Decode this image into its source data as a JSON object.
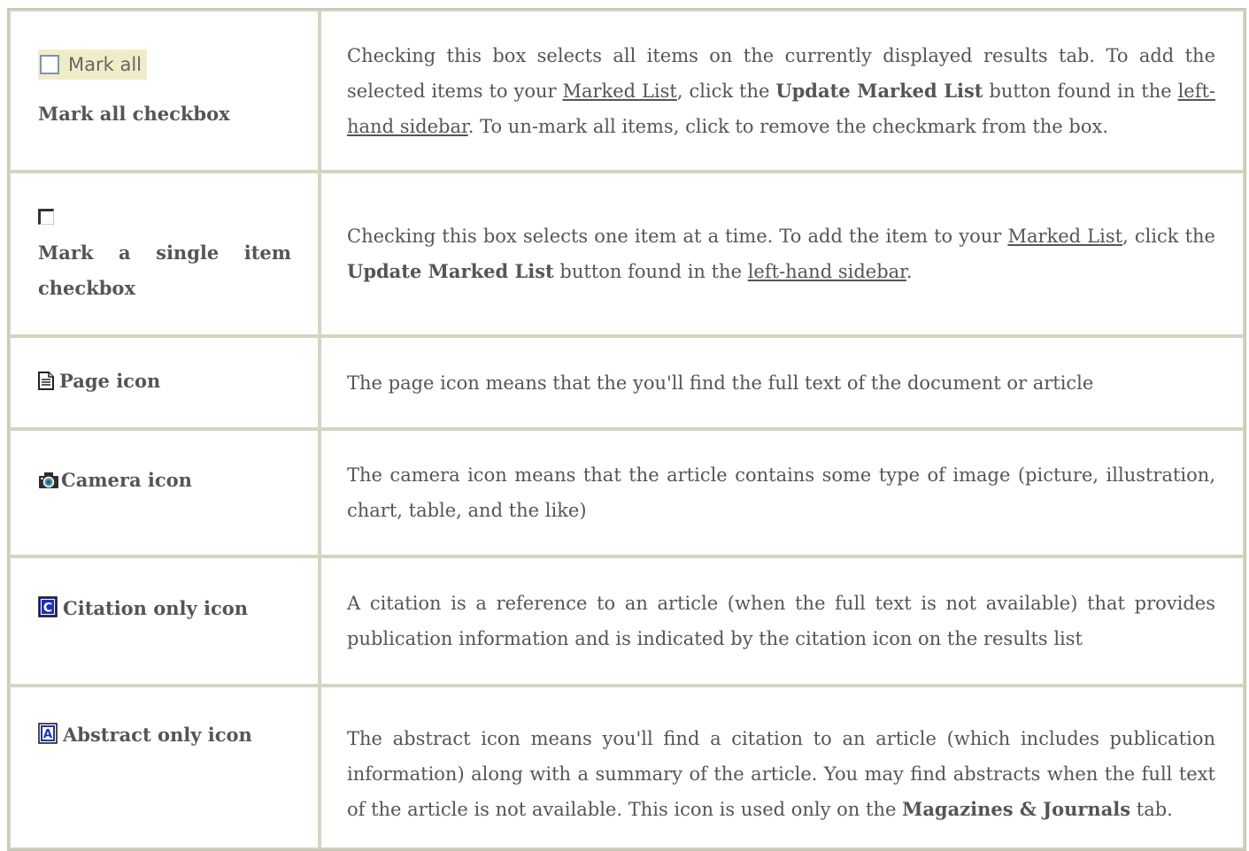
{
  "rows": [
    {
      "widget_label": "Mark all",
      "term": "Mark all checkbox",
      "desc": {
        "p1": "Checking this box selects all items on the currently displayed results tab. To add the selected items to your ",
        "link1": "Marked List",
        "p2": ", click the ",
        "bold1": "Update Marked List",
        "p3": " button found in the ",
        "link2": "left-hand sidebar",
        "p4": ". To un-mark all items, click to remove the checkmark from the box."
      }
    },
    {
      "term": "Mark a single item checkbox",
      "desc": {
        "p1": "Checking this box selects one item at a time. To add the item to your ",
        "link1": "Marked List",
        "p2": ", click the ",
        "bold1": "Update Marked List",
        "p3": " button found in the ",
        "link2": "left-hand sidebar",
        "p4": "."
      }
    },
    {
      "icon": "page-icon",
      "term": "Page icon",
      "desc": {
        "p1": "The page icon means that the you'll find the full text of the document or article"
      }
    },
    {
      "icon": "camera-icon",
      "term": "Camera icon",
      "desc": {
        "p1": "The camera icon means that the article contains some type of image (picture, illustration, chart, table, and the like)"
      }
    },
    {
      "icon": "citation-icon",
      "term": "Citation only icon",
      "desc": {
        "p1": "A citation is a reference to an article (when the full text is not available) that provides publication information and is indicated by the citation icon on the results list"
      }
    },
    {
      "icon": "abstract-icon",
      "term": "Abstract only icon",
      "desc": {
        "p1": "The abstract icon means you'll find a citation to an article (which includes publication information) along with a summary of the article. You may find abstracts when the full text of the article is not available. This icon is used only on the ",
        "bold1": "Magazines & Journals",
        "p2": " tab."
      }
    }
  ],
  "colors": {
    "border": "#d6d3c0",
    "text": "#555555",
    "widget_bg": "#f1ecc8",
    "icon_blue": "#1f2fb5"
  }
}
